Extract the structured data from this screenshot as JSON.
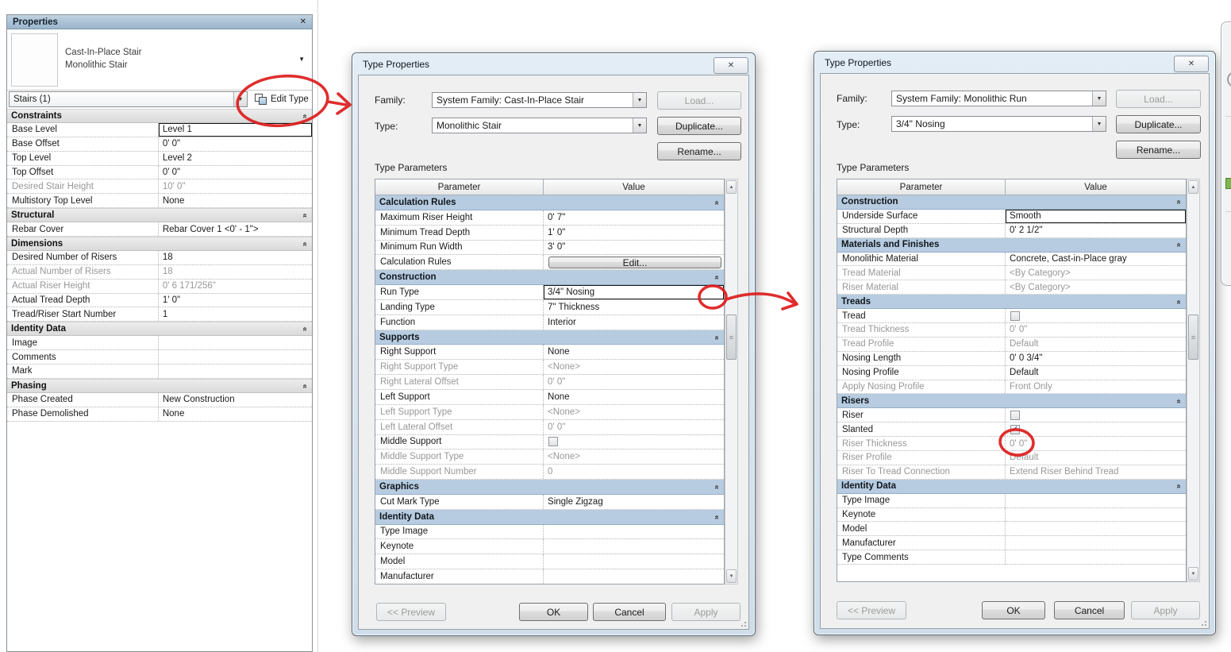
{
  "icons": {
    "close": "✕",
    "dropdown": "▼",
    "section_chevron": "»",
    "check": "✓",
    "scroll_up": "▲",
    "scroll_down": "▼",
    "grip": "≡"
  },
  "palette": {
    "title": "Properties",
    "type_selector": {
      "line1": "Cast-In-Place Stair",
      "line2": "Monolithic Stair"
    },
    "filter": "Stairs (1)",
    "edit_type_label": "Edit Type",
    "sections": [
      {
        "title": "Constraints",
        "rows": [
          {
            "label": "Base Level",
            "value": "Level 1",
            "selected": true
          },
          {
            "label": "Base Offset",
            "value": "0'  0\""
          },
          {
            "label": "Top Level",
            "value": "Level 2"
          },
          {
            "label": "Top Offset",
            "value": "0'  0\""
          },
          {
            "label": "Desired Stair Height",
            "value": "10'  0\"",
            "gray": true
          },
          {
            "label": "Multistory Top Level",
            "value": "None"
          }
        ]
      },
      {
        "title": "Structural",
        "rows": [
          {
            "label": "Rebar Cover",
            "value": "Rebar Cover 1 <0' - 1\">"
          }
        ]
      },
      {
        "title": "Dimensions",
        "rows": [
          {
            "label": "Desired Number of Risers",
            "value": "18"
          },
          {
            "label": "Actual Number of Risers",
            "value": "18",
            "gray": true
          },
          {
            "label": "Actual Riser Height",
            "value": "0'  6 171/256\"",
            "gray": true
          },
          {
            "label": "Actual Tread Depth",
            "value": "1'  0\""
          },
          {
            "label": "Tread/Riser Start Number",
            "value": "1"
          }
        ]
      },
      {
        "title": "Identity Data",
        "rows": [
          {
            "label": "Image",
            "value": ""
          },
          {
            "label": "Comments",
            "value": ""
          },
          {
            "label": "Mark",
            "value": ""
          }
        ]
      },
      {
        "title": "Phasing",
        "rows": [
          {
            "label": "Phase Created",
            "value": "New Construction"
          },
          {
            "label": "Phase Demolished",
            "value": "None"
          }
        ]
      }
    ]
  },
  "dialog1": {
    "title": "Type Properties",
    "family_label": "Family:",
    "family_value": "System Family: Cast-In-Place Stair",
    "type_label": "Type:",
    "type_value": "Monolithic Stair",
    "load_label": "Load...",
    "duplicate_label": "Duplicate...",
    "rename_label": "Rename...",
    "table_caption": "Type Parameters",
    "col_param": "Parameter",
    "col_value": "Value",
    "sections": [
      {
        "title": "Calculation Rules",
        "rows": [
          {
            "label": "Maximum Riser Height",
            "value": "0'  7\""
          },
          {
            "label": "Minimum Tread Depth",
            "value": "1'  0\""
          },
          {
            "label": "Minimum Run Width",
            "value": "3'  0\""
          },
          {
            "label": "Calculation Rules",
            "button": "Edit..."
          }
        ]
      },
      {
        "title": "Construction",
        "rows": [
          {
            "label": "Run Type",
            "value": "3/4\" Nosing",
            "selected": true
          },
          {
            "label": "Landing Type",
            "value": "7\" Thickness"
          },
          {
            "label": "Function",
            "value": "Interior"
          }
        ]
      },
      {
        "title": "Supports",
        "rows": [
          {
            "label": "Right Support",
            "value": "None"
          },
          {
            "label": "Right Support Type",
            "value": "<None>",
            "gray": true
          },
          {
            "label": "Right Lateral Offset",
            "value": "0'  0\"",
            "gray": true
          },
          {
            "label": "Left Support",
            "value": "None"
          },
          {
            "label": "Left Support Type",
            "value": "<None>",
            "gray": true
          },
          {
            "label": "Left Lateral Offset",
            "value": "0'  0\"",
            "gray": true
          },
          {
            "label": "Middle Support",
            "checkbox": true,
            "checked": false
          },
          {
            "label": "Middle Support Type",
            "value": "<None>",
            "gray": true
          },
          {
            "label": "Middle Support Number",
            "value": "0",
            "gray": true
          }
        ]
      },
      {
        "title": "Graphics",
        "rows": [
          {
            "label": "Cut Mark Type",
            "value": "Single Zigzag"
          }
        ]
      },
      {
        "title": "Identity Data",
        "rows": [
          {
            "label": "Type Image",
            "value": ""
          },
          {
            "label": "Keynote",
            "value": ""
          },
          {
            "label": "Model",
            "value": ""
          },
          {
            "label": "Manufacturer",
            "value": ""
          }
        ]
      }
    ],
    "buttons": {
      "preview": "<< Preview",
      "ok": "OK",
      "cancel": "Cancel",
      "apply": "Apply"
    }
  },
  "dialog2": {
    "title": "Type Properties",
    "family_label": "Family:",
    "family_value": "System Family: Monolithic Run",
    "type_label": "Type:",
    "type_value": "3/4\" Nosing",
    "load_label": "Load...",
    "duplicate_label": "Duplicate...",
    "rename_label": "Rename...",
    "table_caption": "Type Parameters",
    "col_param": "Parameter",
    "col_value": "Value",
    "sections": [
      {
        "title": "Construction",
        "rows": [
          {
            "label": "Underside Surface",
            "value": "Smooth",
            "selected": true
          },
          {
            "label": "Structural Depth",
            "value": "0'  2 1/2\""
          }
        ]
      },
      {
        "title": "Materials and Finishes",
        "rows": [
          {
            "label": "Monolithic Material",
            "value": "Concrete, Cast-in-Place gray"
          },
          {
            "label": "Tread Material",
            "value": "<By Category>",
            "gray": true
          },
          {
            "label": "Riser Material",
            "value": "<By Category>",
            "gray": true
          }
        ]
      },
      {
        "title": "Treads",
        "rows": [
          {
            "label": "Tread",
            "checkbox": true,
            "checked": false
          },
          {
            "label": "Tread Thickness",
            "value": "0'  0\"",
            "gray": true
          },
          {
            "label": "Tread Profile",
            "value": "Default",
            "gray": true
          },
          {
            "label": "Nosing Length",
            "value": "0'  0 3/4\""
          },
          {
            "label": "Nosing Profile",
            "value": "Default"
          },
          {
            "label": "Apply Nosing Profile",
            "value": "Front Only",
            "gray": true
          }
        ]
      },
      {
        "title": "Risers",
        "rows": [
          {
            "label": "Riser",
            "checkbox": true,
            "checked": false
          },
          {
            "label": "Slanted",
            "checkbox": true,
            "checked": true
          },
          {
            "label": "Riser Thickness",
            "value": "0'  0\"",
            "gray": true
          },
          {
            "label": "Riser Profile",
            "value": "Default",
            "gray": true
          },
          {
            "label": "Riser To Tread Connection",
            "value": "Extend Riser Behind Tread",
            "gray": true
          }
        ]
      },
      {
        "title": "Identity Data",
        "rows": [
          {
            "label": "Type Image",
            "value": ""
          },
          {
            "label": "Keynote",
            "value": ""
          },
          {
            "label": "Model",
            "value": ""
          },
          {
            "label": "Manufacturer",
            "value": ""
          },
          {
            "label": "Type Comments",
            "value": ""
          }
        ]
      }
    ],
    "buttons": {
      "preview": "<< Preview",
      "ok": "OK",
      "cancel": "Cancel",
      "apply": "Apply"
    }
  },
  "annotation_color": "#de1c1c"
}
